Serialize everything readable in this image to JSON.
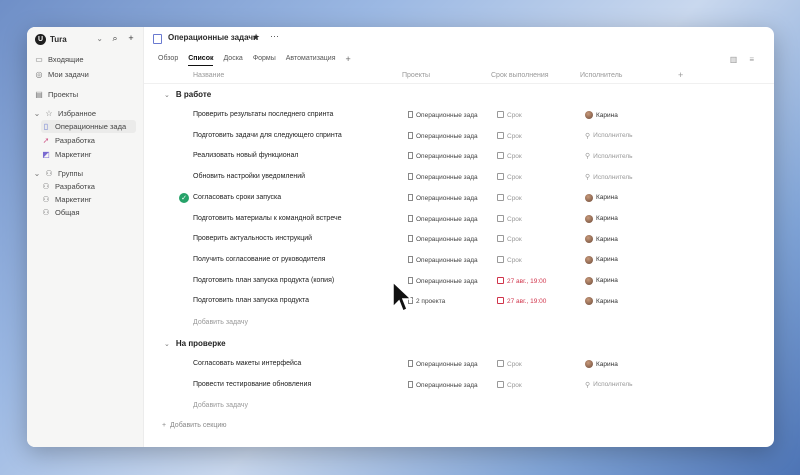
{
  "sidebar": {
    "workspace": "Tura",
    "items": [
      {
        "label": "Входящие",
        "icon": "inbox-icon"
      },
      {
        "label": "Мои задачи",
        "icon": "check-circle-icon"
      },
      {
        "label": "Проекты",
        "icon": "folder-icon"
      },
      {
        "label": "Избранное",
        "icon": "star-icon"
      },
      {
        "label": "Операционные зада",
        "icon": "board-icon"
      },
      {
        "label": "Разработка",
        "icon": "rocket-icon"
      },
      {
        "label": "Маркетинг",
        "icon": "megaphone-icon"
      },
      {
        "label": "Группы",
        "icon": "people-icon"
      },
      {
        "label": "Разработка",
        "icon": "people-icon"
      },
      {
        "label": "Маркетинг",
        "icon": "people-icon"
      },
      {
        "label": "Общая",
        "icon": "people-icon"
      }
    ]
  },
  "header": {
    "title": "Операционные задачи",
    "tabs": [
      "Обзор",
      "Список",
      "Доска",
      "Формы",
      "Автоматизация"
    ],
    "active_tab": "Список"
  },
  "columns": {
    "name": "Название",
    "project": "Проекты",
    "due": "Срок выполнения",
    "assignee": "Исполнитель"
  },
  "sections": [
    {
      "title": "В работе",
      "add_task": "Добавить задачу",
      "tasks": [
        {
          "name": "Проверить результаты последнего спринта",
          "project": "Операционные зада",
          "due": "Срок",
          "due_overdue": false,
          "assignee": "Карина",
          "done": false
        },
        {
          "name": "Подготовить задачи для следующего спринта",
          "project": "Операционные зада",
          "due": "Срок",
          "due_overdue": false,
          "assignee": "Исполнитель",
          "done": false
        },
        {
          "name": "Реализовать новый функционал",
          "project": "Операционные зада",
          "due": "Срок",
          "due_overdue": false,
          "assignee": "Исполнитель",
          "done": false
        },
        {
          "name": "Обновить настройки уведомлений",
          "project": "Операционные зада",
          "due": "Срок",
          "due_overdue": false,
          "assignee": "Исполнитель",
          "done": false
        },
        {
          "name": "Согласовать сроки запуска",
          "project": "Операционные зада",
          "due": "Срок",
          "due_overdue": false,
          "assignee": "Карина",
          "done": true
        },
        {
          "name": "Подготовить материалы к командной встрече",
          "project": "Операционные зада",
          "due": "Срок",
          "due_overdue": false,
          "assignee": "Карина",
          "done": false
        },
        {
          "name": "Проверить актуальность инструкций",
          "project": "Операционные зада",
          "due": "Срок",
          "due_overdue": false,
          "assignee": "Карина",
          "done": false
        },
        {
          "name": "Получить согласование от руководителя",
          "project": "Операционные зада",
          "due": "Срок",
          "due_overdue": false,
          "assignee": "Карина",
          "done": false
        },
        {
          "name": "Подготовить план запуска продукта (копия)",
          "project": "Операционные зада",
          "due": "27 авг., 19:00",
          "due_overdue": true,
          "assignee": "Карина",
          "done": false
        },
        {
          "name": "Подготовить план запуска продукта",
          "project": "2 проекта",
          "due": "27 авг., 19:00",
          "due_overdue": true,
          "assignee": "Карина",
          "done": false
        }
      ]
    },
    {
      "title": "На проверке",
      "add_task": "Добавить задачу",
      "tasks": [
        {
          "name": "Согласовать макеты интерфейса",
          "project": "Операционные зада",
          "due": "Срок",
          "due_overdue": false,
          "assignee": "Карина",
          "done": false
        },
        {
          "name": "Провести тестирование обновления",
          "project": "Операционные зада",
          "due": "Срок",
          "due_overdue": false,
          "assignee": "Исполнитель",
          "done": false
        }
      ]
    }
  ],
  "add_section": "Добавить секцию",
  "colors": {
    "accent": "#6a7ad0",
    "done": "#26a269",
    "overdue": "#d0344b"
  }
}
